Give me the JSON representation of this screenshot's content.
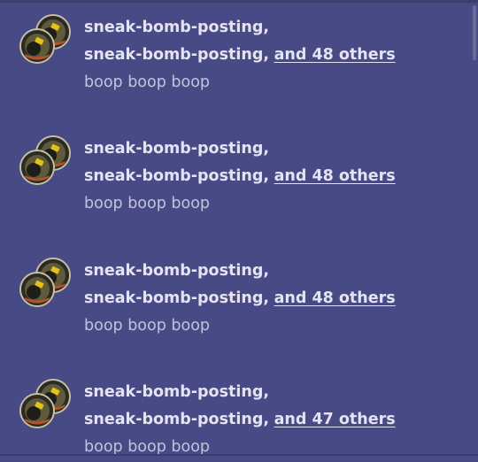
{
  "colors": {
    "background": "#484a86",
    "name_text": "#e3e3f1",
    "message_text": "#c2c3db"
  },
  "activity": [
    {
      "avatar_icons": [
        "bomb-avatar-icon",
        "bomb-avatar-icon"
      ],
      "first_name": "sneak-bomb-posting,",
      "second_name": "sneak-bomb-posting,",
      "others_link": "and 48 others",
      "message": "boop boop boop"
    },
    {
      "avatar_icons": [
        "bomb-avatar-icon",
        "bomb-avatar-icon"
      ],
      "first_name": "sneak-bomb-posting,",
      "second_name": "sneak-bomb-posting,",
      "others_link": "and 48 others",
      "message": "boop boop boop"
    },
    {
      "avatar_icons": [
        "bomb-avatar-icon",
        "bomb-avatar-icon"
      ],
      "first_name": "sneak-bomb-posting,",
      "second_name": "sneak-bomb-posting,",
      "others_link": "and 48 others",
      "message": "boop boop boop"
    },
    {
      "avatar_icons": [
        "bomb-avatar-icon",
        "bomb-avatar-icon"
      ],
      "first_name": "sneak-bomb-posting,",
      "second_name": "sneak-bomb-posting,",
      "others_link": "and 47 others",
      "message": "boop boop boop"
    }
  ]
}
